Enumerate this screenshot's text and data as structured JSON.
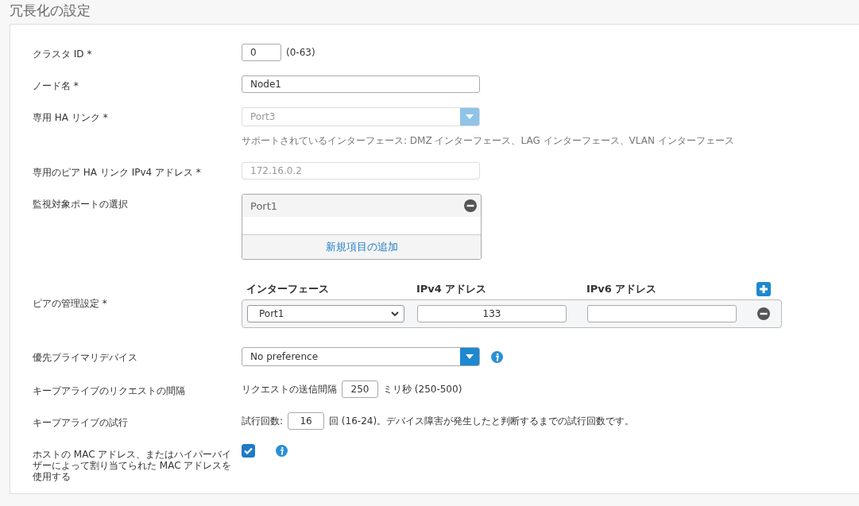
{
  "title": "冗長化の設定",
  "fields": [
    {
      "kind": "number",
      "label": "クラスタ ID *",
      "value": "0",
      "suffix": "(0-63)"
    },
    {
      "kind": "text",
      "label": "ノード名 *",
      "value": "Node1",
      "disabled": false
    },
    {
      "kind": "dropdown",
      "label": "専用 HA リンク *",
      "value": "Port3",
      "disabled": true,
      "hint": "サポートされているインターフェース: DMZ インターフェース、LAG インターフェース、VLAN インターフェース"
    },
    {
      "kind": "text",
      "label": "専用のピア HA リンク IPv4 アドレス *",
      "value": "172.16.0.2",
      "disabled": true
    },
    {
      "kind": "portlist",
      "label": "監視対象ポートの選択",
      "items": [
        "Port1"
      ],
      "add_label": "新規項目の追加"
    },
    {
      "kind": "peer",
      "label": "ピアの管理設定 *",
      "columns": [
        "インターフェース",
        "IPv4 アドレス",
        "IPv6 アドレス"
      ],
      "rows": [
        {
          "interface": "Port1",
          "ipv4": "133",
          "ipv6": ""
        }
      ]
    },
    {
      "kind": "dropdown",
      "label": "優先プライマリデバイス",
      "value": "No preference",
      "disabled": false,
      "info": true
    },
    {
      "kind": "inline",
      "label": "キープアライブのリクエストの間隔",
      "prefix": "リクエストの送信間隔",
      "value": "250",
      "suffix": "ミリ秒 (250-500)"
    },
    {
      "kind": "inline",
      "label": "キープアライブの試行",
      "prefix": "試行回数:",
      "value": "16",
      "suffix": "回 (16-24)。デバイス障害が発生したと判断するまでの試行回数です。"
    },
    {
      "kind": "checkbox",
      "label": "ホストの MAC アドレス、またはハイパーバイザーによって割り当てられた MAC アドレスを使用する",
      "checked": true,
      "info": true
    }
  ]
}
